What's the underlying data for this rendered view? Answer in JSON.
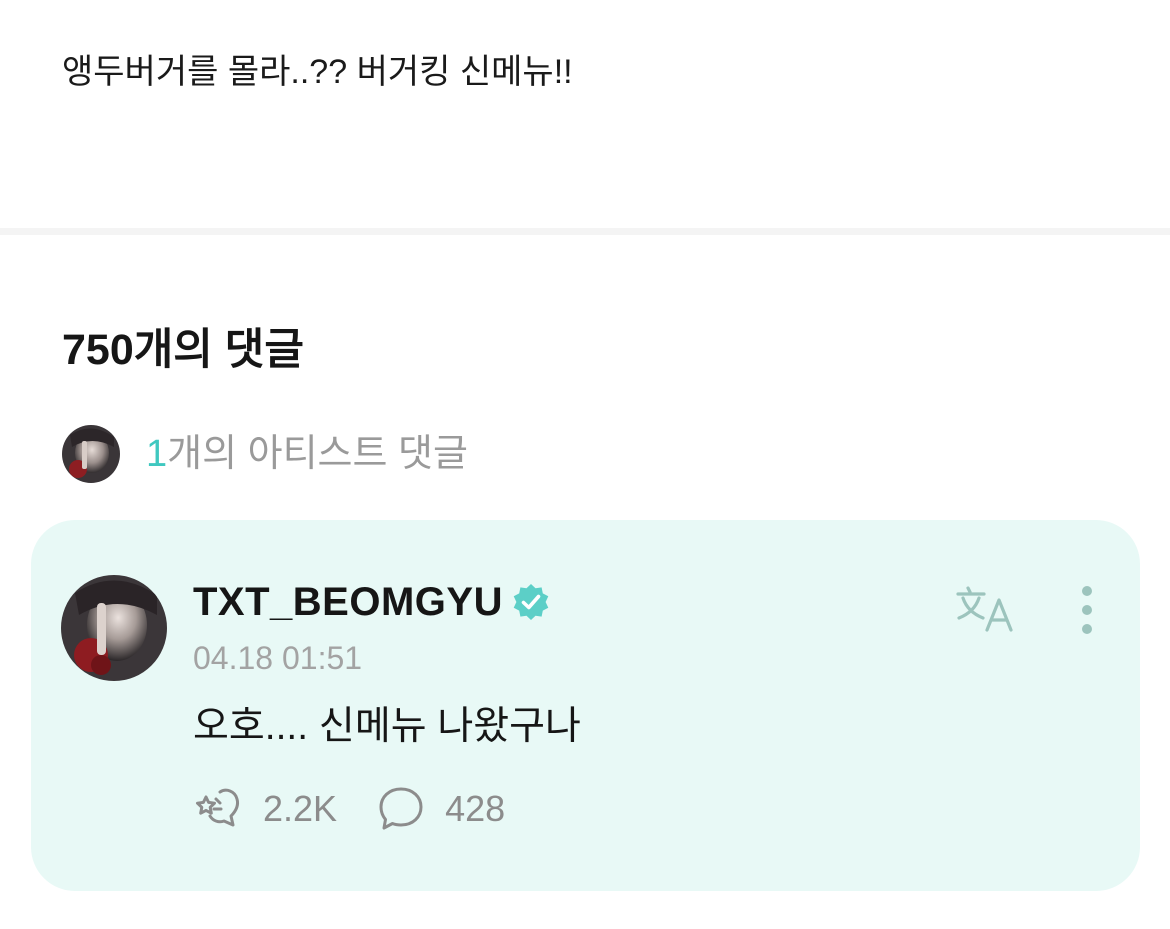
{
  "post": {
    "text": "앵두버거를 몰라..?? 버거킹 신메뉴!!"
  },
  "comments": {
    "heading": "750개의 댓글",
    "artist_summary": {
      "count": "1",
      "label": "개의 아티스트 댓글"
    }
  },
  "artist_comment": {
    "author": "TXT_BEOMGYU",
    "verified": true,
    "timestamp": "04.18 01:51",
    "body": "오호.... 신메뉴 나왔구나",
    "likes": "2.2K",
    "replies": "428",
    "icons": {
      "verified": "verified-badge-icon",
      "translate": "translate-icon",
      "more": "more-vertical-icon",
      "like": "cheer-heart-icon",
      "reply": "speech-bubble-icon"
    }
  },
  "colors": {
    "accent": "#3fc8c0",
    "card_background": "#e8f9f6",
    "secondary_text": "#9a9a9a",
    "icon_gray": "#8c8c8c",
    "divider": "#f4f4f4"
  }
}
